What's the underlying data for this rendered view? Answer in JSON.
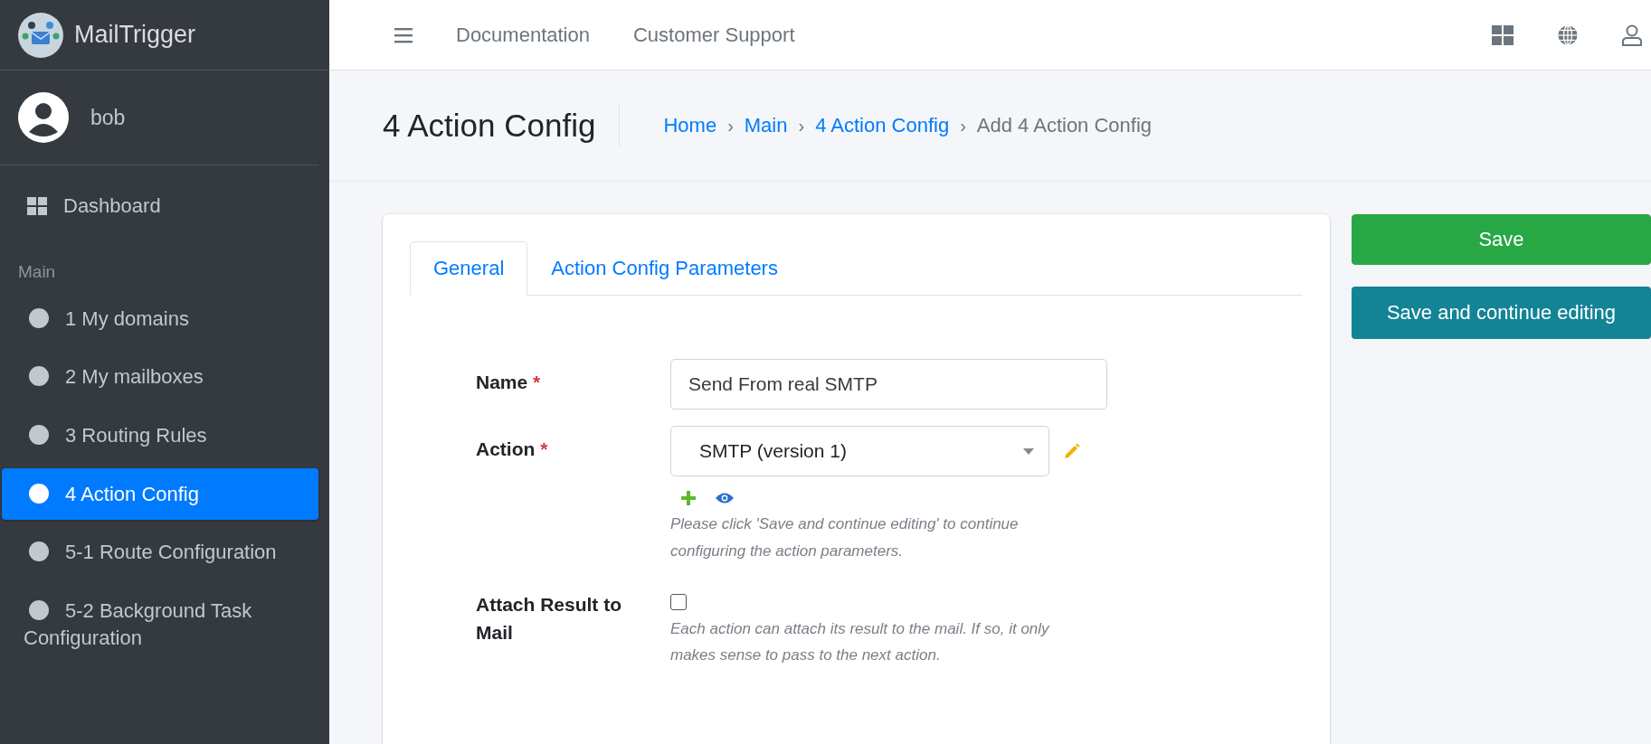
{
  "brand": {
    "name": "MailTrigger"
  },
  "user": {
    "name": "bob"
  },
  "sidebar": {
    "items": [
      {
        "kind": "grid",
        "label": "Dashboard",
        "selected": false
      },
      {
        "kind": "header",
        "label": "Main"
      },
      {
        "kind": "circle",
        "label": "1 My domains",
        "selected": false
      },
      {
        "kind": "circle",
        "label": "2 My mailboxes",
        "selected": false
      },
      {
        "kind": "circle",
        "label": "3 Routing Rules",
        "selected": false
      },
      {
        "kind": "circle",
        "label": "4 Action Config",
        "selected": true
      },
      {
        "kind": "circle",
        "label": "5-1 Route Configuration",
        "selected": false
      },
      {
        "kind": "circle",
        "label": "5-2 Background Task Configuration",
        "selected": false
      }
    ]
  },
  "topbar": {
    "links": [
      "Documentation",
      "Customer Support"
    ]
  },
  "page": {
    "title": "4 Action Config",
    "breadcrumb": [
      {
        "label": "Home",
        "kind": "link"
      },
      {
        "label": "Main",
        "kind": "link"
      },
      {
        "label": "4 Action Config",
        "kind": "link"
      },
      {
        "label": "Add 4 Action Config",
        "kind": "current"
      }
    ],
    "separator": "›"
  },
  "tabs": [
    {
      "label": "General",
      "selected": true
    },
    {
      "label": "Action Config Parameters",
      "selected": false
    }
  ],
  "fields": [
    {
      "kind": "text",
      "label": "Name",
      "required_mark": "*",
      "value": "Send From real SMTP"
    },
    {
      "kind": "select",
      "label": "Action",
      "required_mark": "*",
      "value": "SMTP (version 1)",
      "help": "Please click 'Save and continue editing' to continue configuring the action parameters."
    },
    {
      "kind": "checkbox",
      "label": "Attach Result to Mail",
      "checked": false,
      "help": "Each action can attach its result to the mail. If so, it only makes sense to pass to the next action."
    }
  ],
  "buttons": [
    {
      "label": "Save",
      "kind": "success"
    },
    {
      "label": "Save and continue editing",
      "kind": "info"
    }
  ]
}
